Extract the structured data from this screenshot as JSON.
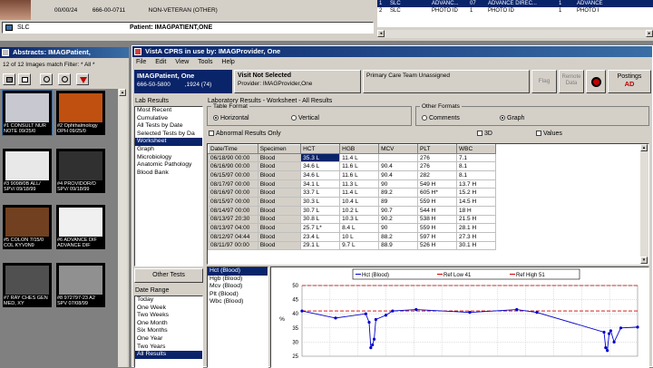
{
  "background_window": {
    "patient_row": {
      "id": "00/00/24",
      "ssn": "666-00-0711",
      "status": "NON-VETERAN (OTHER)"
    },
    "slc_label": "SLC",
    "patient_label": "Patient: IMAGPATIENT,ONE",
    "right_table": [
      {
        "num": "1",
        "site": "SLC",
        "type": "ADVANC...",
        "count": "07",
        "desc": "ADVANCE DIREC...",
        "n": "1",
        "short": "ADVANCE"
      },
      {
        "num": "2",
        "site": "SLC",
        "type": "PHOTO ID",
        "count": "1",
        "desc": "PHOTO ID",
        "n": "1",
        "short": "PHOTO I"
      }
    ]
  },
  "abstracts": {
    "title": "Abstracts: IMAGPatient,",
    "filter_text": "12 of 12 Images match Filter: * All *",
    "thumbnails": [
      {
        "caption": "#1 CONSULT NUR NOTE 09/25/0",
        "color": "#c8c8d0"
      },
      {
        "caption": "#2 Ophthalmology OPH 09/25/0",
        "color": "#c05010"
      },
      {
        "caption": "#3 9098/0B ALL/ SPV/ 09/18/99",
        "color": "#e8e8e8"
      },
      {
        "caption": "#4 PROVIDOR/O SPV/ 09/18/99",
        "color": "#303030"
      },
      {
        "caption": "#5 COLON 7/15/0 COL KYV0N9",
        "color": "#704020"
      },
      {
        "caption": "#6 ADVANCE DIF ADVANCE DIF",
        "color": "#f0f0f0"
      },
      {
        "caption": "#7 RAY CHES GEN MED, XY",
        "color": "#505050"
      },
      {
        "caption": "#8 972797-23 A2 SPV 07/08/99",
        "color": "#909090"
      }
    ]
  },
  "cprs": {
    "title": "VistA CPRS in use by: IMAGProvider, One",
    "menu": [
      "File",
      "Edit",
      "View",
      "Tools",
      "Help"
    ],
    "patient_name": "IMAGPatient, One",
    "patient_ssn": "666-50-5800",
    "patient_dob": ",1924 (74)",
    "visit_title": "Visit Not Selected",
    "provider": "Provider: IMAGProvider,One",
    "care_team": "Primary Care Team Unassigned",
    "flag_label": "Flag",
    "remote_label": "Remote Data",
    "postings_label": "Postings",
    "postings_value": "AD",
    "lab_results_label": "Lab Results",
    "lab_menu": [
      "Most Recent",
      "Cumulative",
      "All Tests by Date",
      "Selected Tests by Da",
      "Worksheet",
      "Graph",
      "Microbiology",
      "Anatomic Pathology",
      "Blood Bank"
    ],
    "lab_menu_selected": 4,
    "worksheet_title": "Laboratory Results - Worksheet - All Results",
    "table_format_label": "Table Format",
    "horizontal_label": "Horizontal",
    "vertical_label": "Vertical",
    "other_formats_label": "Other Formats",
    "comments_label": "Comments",
    "graph_label": "Graph",
    "abnormal_label": "Abnormal Results Only",
    "threed_label": "3D",
    "values_label": "Values",
    "columns": [
      "Date/Time",
      "Specimen",
      "HCT",
      "HGB",
      "MCV",
      "PLT",
      "WBC"
    ],
    "rows": [
      [
        "06/18/90 00:00",
        "Blood",
        "35.3 L",
        "11.4 L",
        "",
        "276",
        "7.1"
      ],
      [
        "06/16/90 00:00",
        "Blood",
        "34.6 L",
        "11.6 L",
        "90.4",
        "276",
        "8.1"
      ],
      [
        "06/15/97 00:00",
        "Blood",
        "34.6 L",
        "11.6 L",
        "90.4",
        "282",
        "8.1"
      ],
      [
        "08/17/97 00:00",
        "Blood",
        "34.1 L",
        "11.3 L",
        "90",
        "549 H",
        "13.7 H"
      ],
      [
        "08/16/97 00:00",
        "Blood",
        "33.7 L",
        "11.4 L",
        "89.2",
        "605 H*",
        "15.2 H"
      ],
      [
        "08/15/97 00:00",
        "Blood",
        "30.3 L",
        "10.4 L",
        "89",
        "559 H",
        "14.5 H"
      ],
      [
        "08/14/97 00:00",
        "Blood",
        "30.7 L",
        "10.2 L",
        "90.7",
        "544 H",
        "18 H"
      ],
      [
        "08/13/97 20:30",
        "Blood",
        "30.8 L",
        "10.3 L",
        "90.2",
        "538 H",
        "21.5 H"
      ],
      [
        "08/13/97 04:00",
        "Blood",
        "25.7 L*",
        "8.4 L",
        "90",
        "559 H",
        "28.1 H"
      ],
      [
        "08/12/97 04:44",
        "Blood",
        "23.4 L",
        "10 L",
        "88.2",
        "597 H",
        "27.3 H"
      ],
      [
        "08/11/97 00:00",
        "Blood",
        "29.1 L",
        "9.7 L",
        "88.9",
        "526 H",
        "30.1 H"
      ]
    ],
    "selected_cell": {
      "row": 0,
      "col": 2
    },
    "other_tests_label": "Other Tests",
    "date_range_label": "Date Range",
    "date_ranges": [
      "Today",
      "One Week",
      "Two Weeks",
      "One Month",
      "Six Months",
      "One Year",
      "Two Years",
      "All Results"
    ],
    "date_range_selected": 7,
    "graph_tests": [
      "Hct (Blood)",
      "Hgb (Blood)",
      "Mcv (Blood)",
      "Plt (Blood)",
      "Wbc (Blood)"
    ],
    "graph_tests_selected": 0
  },
  "chart_data": {
    "type": "line",
    "legend": [
      "Hct (Blood)",
      "Ref Low 41",
      "Ref High 51"
    ],
    "legend_placement": "top",
    "ylim": [
      25,
      50
    ],
    "yticks": [
      "50",
      "45",
      "40",
      "35",
      "30",
      "25"
    ],
    "ylabel": "%",
    "ref_low": 41,
    "ref_high": 51,
    "series": [
      {
        "name": "Hct (Blood)",
        "color": "#0000cc",
        "values": [
          [
            0,
            41
          ],
          [
            0.1,
            38.5
          ],
          [
            0.19,
            40
          ],
          [
            0.2,
            37
          ],
          [
            0.205,
            28
          ],
          [
            0.21,
            29
          ],
          [
            0.215,
            31
          ],
          [
            0.22,
            38
          ],
          [
            0.25,
            39.5
          ],
          [
            0.27,
            41
          ],
          [
            0.34,
            41.5
          ],
          [
            0.5,
            40.5
          ],
          [
            0.64,
            41.5
          ],
          [
            0.7,
            40.5
          ],
          [
            0.9,
            33.5
          ],
          [
            0.905,
            28
          ],
          [
            0.91,
            27
          ],
          [
            0.915,
            33
          ],
          [
            0.92,
            34
          ],
          [
            0.93,
            30
          ],
          [
            0.95,
            35
          ],
          [
            1.0,
            35.3
          ]
        ]
      }
    ],
    "ref_color": "#cc0000",
    "grid": true
  }
}
